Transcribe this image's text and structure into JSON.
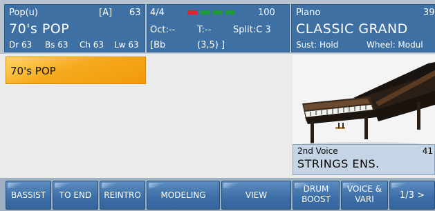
{
  "style_panel": {
    "category": "Pop(u)",
    "variation": "[A]",
    "number": "63",
    "name": "70's POP",
    "volumes": [
      "Dr 63",
      "Bs 63",
      "Ch 63",
      "Lw 63"
    ]
  },
  "info_panel": {
    "time_signature": "4/4",
    "tempo": "100",
    "octave": "Oct:--",
    "transpose": "T:--",
    "split": "Split:C 3",
    "chord": "[Bb",
    "position": "(3,5) ]",
    "beat_leds": [
      {
        "color": "#d12b2b"
      },
      {
        "color": "#1f9a3a"
      },
      {
        "color": "#1f9a3a"
      },
      {
        "color": "#1f9a3a"
      }
    ]
  },
  "voice_panel": {
    "category": "Piano",
    "number": "39",
    "name": "CLASSIC GRAND",
    "sustain": "Sust: Hold",
    "wheel": "Wheel: Modul"
  },
  "style_list": {
    "selected": "70's POP"
  },
  "second_voice": {
    "label": "2nd Voice",
    "number": "41",
    "name": "STRINGS ENS."
  },
  "function_buttons": {
    "bassist": "BASSIST",
    "to_end": "TO END",
    "reintro": "REINTRO",
    "modeling": "MODELING",
    "view": "VIEW",
    "drum_boost_1": "DRUM",
    "drum_boost_2": "BOOST",
    "voice_vari_1": "VOICE &",
    "voice_vari_2": "VARI",
    "page": "1/3 >"
  },
  "colors": {
    "panel_blue": "#3f70a4",
    "selected_orange": "#f5aa1c"
  }
}
